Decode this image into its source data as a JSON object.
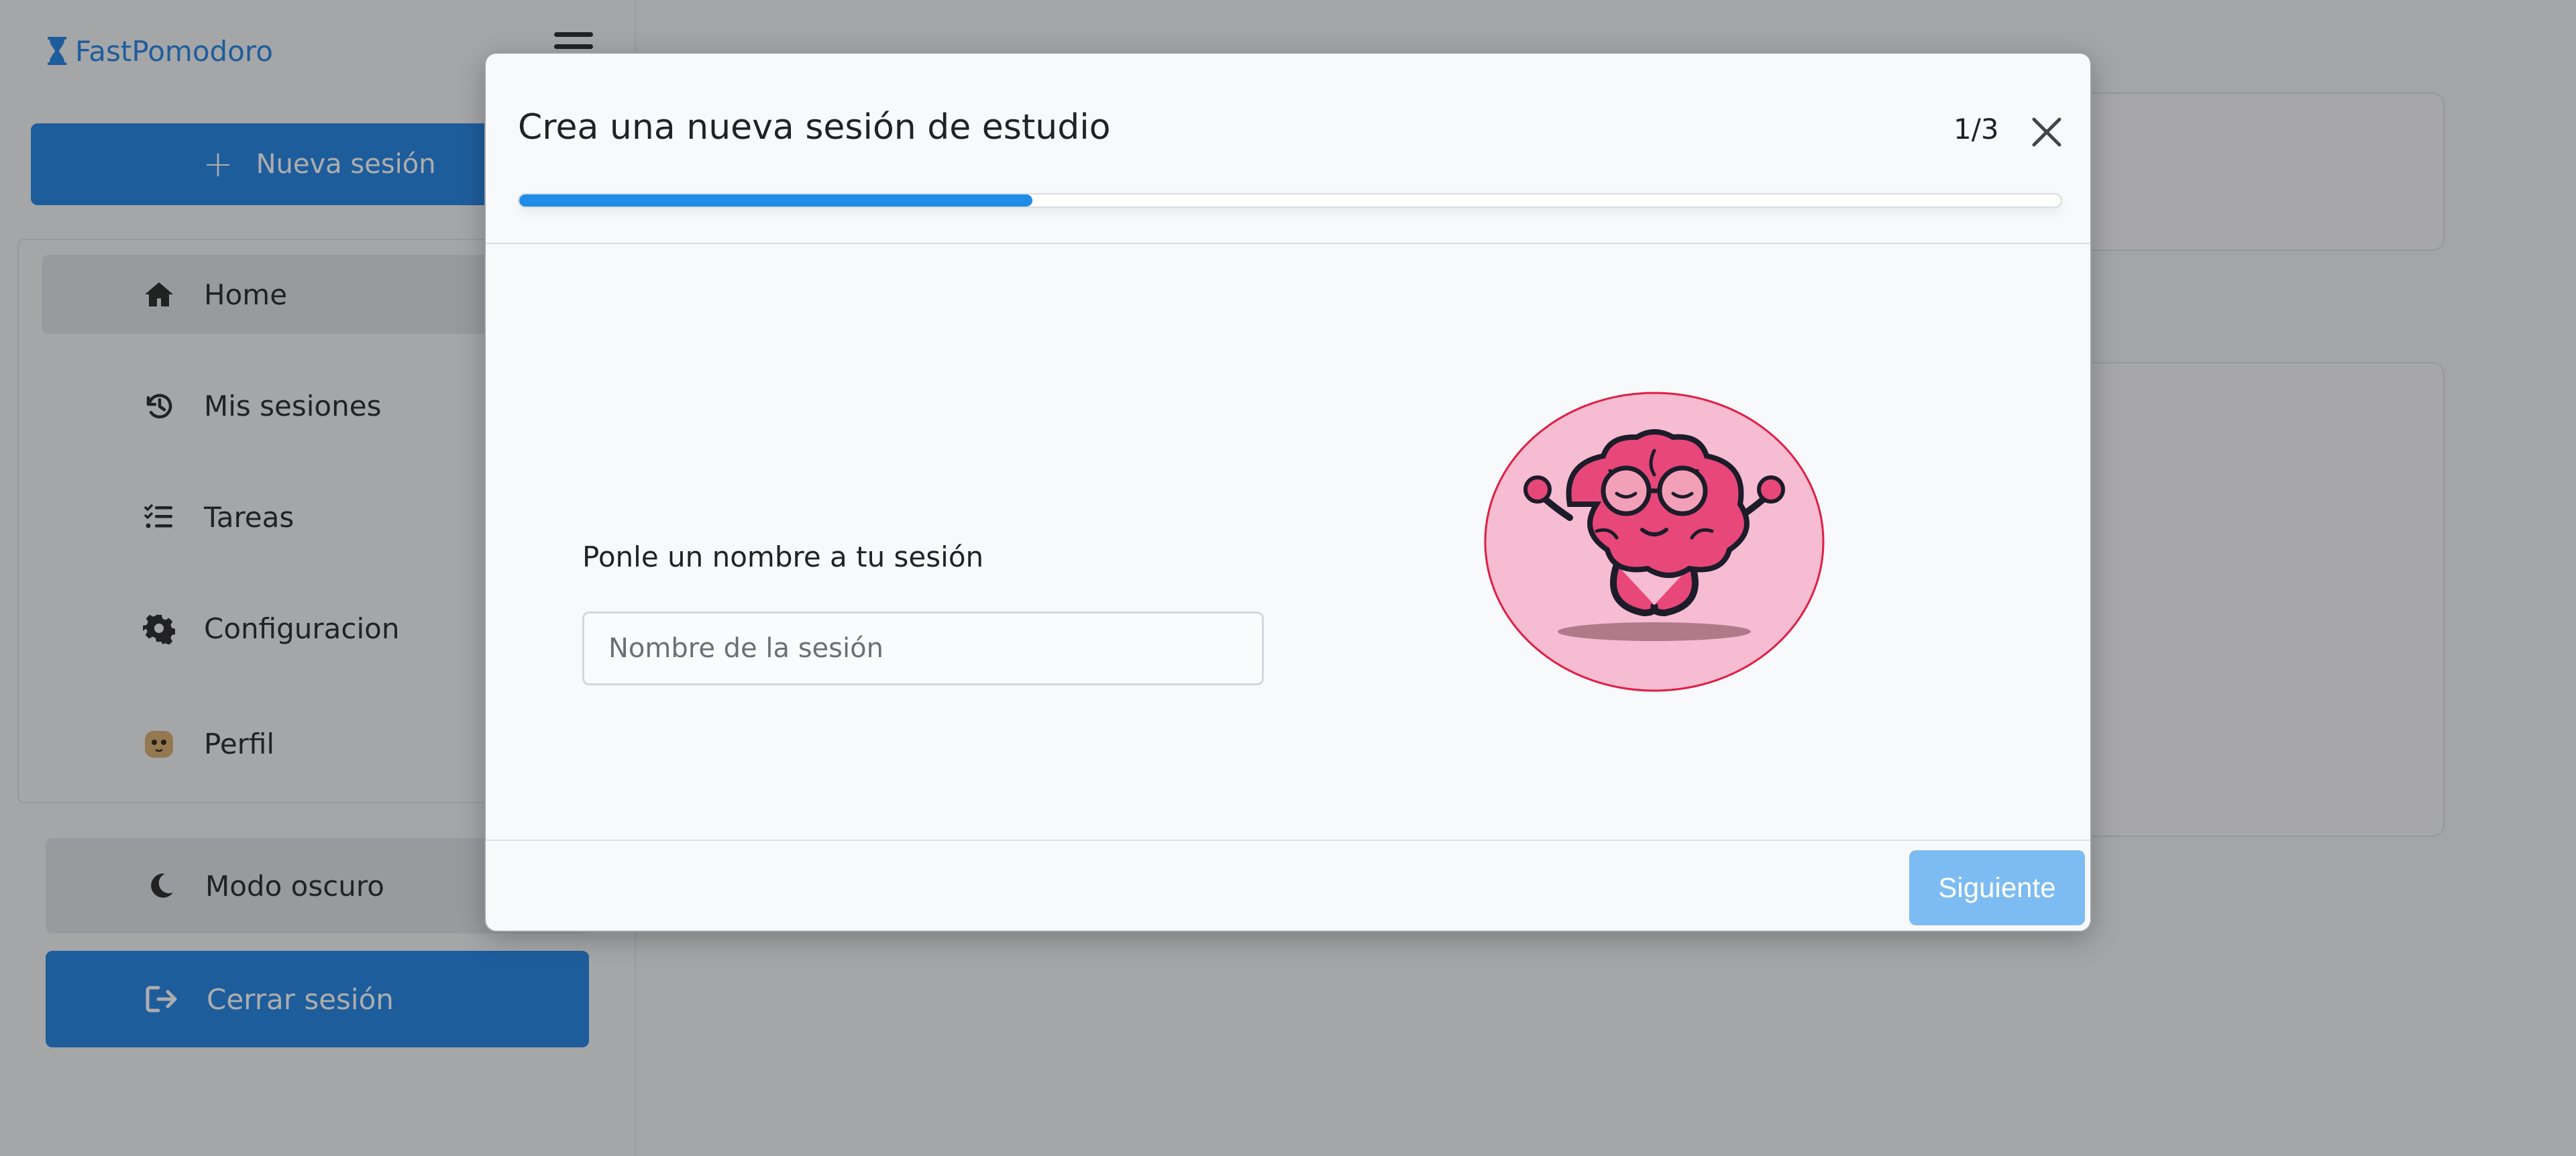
{
  "brand": {
    "name": "FastPomodoro",
    "icon": "hourglass-icon"
  },
  "sidebar": {
    "new_session_label": "Nueva sesión",
    "items": [
      {
        "label": "Home",
        "icon": "home-icon",
        "active": true
      },
      {
        "label": "Mis sesiones",
        "icon": "history-icon",
        "active": false
      },
      {
        "label": "Tareas",
        "icon": "tasks-icon",
        "active": false
      },
      {
        "label": "Configuracion",
        "icon": "gear-icon",
        "active": false
      },
      {
        "label": "Perfil",
        "icon": "avatar-icon",
        "active": false
      }
    ],
    "dark_mode_label": "Modo oscuro",
    "logout_label": "Cerrar sesión"
  },
  "modal": {
    "title": "Crea una nueva sesión de estudio",
    "step": "1/3",
    "progress_fraction": 0.333,
    "field_label": "Ponle un nombre a tu sesión",
    "field_placeholder": "Nombre de la sesión",
    "field_value": "",
    "illustration": "meditating-brain-illustration",
    "next_label": "Siguiente"
  },
  "colors": {
    "accent": "#2d8ae6",
    "progress": "#1f8ce8",
    "next_button_disabled": "#7dbcf2",
    "illustration_bg": "#f6bcd2",
    "illustration_border": "#e01e45"
  }
}
